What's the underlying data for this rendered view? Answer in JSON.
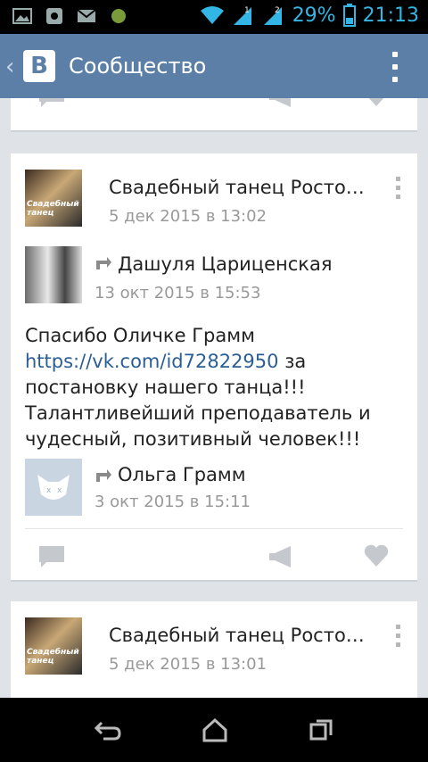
{
  "status_bar": {
    "battery": "29%",
    "time": "21:13",
    "sim1": "1",
    "sim2": "2"
  },
  "header": {
    "logo": "B",
    "title": "Сообщество"
  },
  "post1": {
    "group_name": "Свадебный танец Росто…",
    "date": "5 дек 2015 в 13:02",
    "avatar_text": "Свадебный танец",
    "repost_name": "Дашуля Цариценская",
    "repost_date": "13 окт 2015 в 15:53",
    "text_plain": "Спасибо Оличке Грамм ",
    "text_link": "https://vk.com/id72822950",
    "text_rest": " за постановку нашего танца!!! Талантливейший преподаватель и чудесный, позитивный человек!!!",
    "author_name": "Ольга Грамм",
    "author_date": "3 окт 2015 в 15:11"
  },
  "post2": {
    "group_name": "Свадебный танец Росто…",
    "date": "5 дек 2015 в 13:01",
    "avatar_text": "Свадебный танец"
  },
  "icons": {
    "comment": "comment-icon",
    "share": "share-icon",
    "like": "heart-icon"
  },
  "colors": {
    "header": "#5b7fa6",
    "link": "#2b5e95",
    "status": "#33b5e5"
  }
}
